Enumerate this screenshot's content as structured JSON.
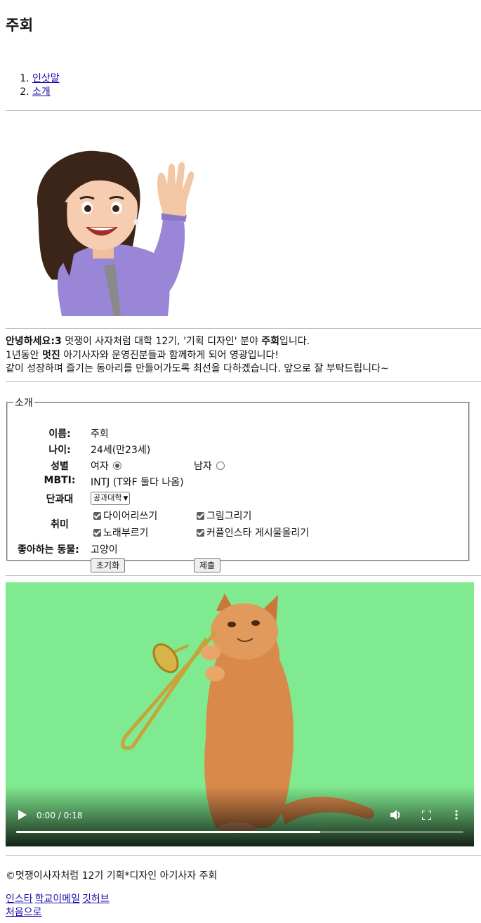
{
  "header": {
    "title": "주회"
  },
  "toc": {
    "items": [
      "인삿말",
      "소개"
    ]
  },
  "greeting": {
    "line1_bold": "안녕하세요:3",
    "line1_rest_a": " 멋쟁이 사자처럼 대학 12기, '기획 디자인' 분야 ",
    "line1_name": "주회",
    "line1_end": "입니다.",
    "line2_a": "1년동안 ",
    "line2_bold": "멋진",
    "line2_b": " 아기사자와 운영진분들과 함께하게 되어 영광입니다!",
    "line3": "같이 성장하며 즐기는 동아리를 만들어가도록 최선을 다하겠습니다. 앞으로 잘 부탁드립니다~"
  },
  "profile": {
    "legend": "소개",
    "name_label": "이름:",
    "name_value": "주회",
    "age_label": "나이:",
    "age_value": "24세(만23세)",
    "gender_label": "성별",
    "gender_female": "여자",
    "gender_male": "남자",
    "mbti_label": "MBTI:",
    "mbti_value": "INTJ (T와F 둘다 나옴)",
    "college_label": "단과대",
    "college_selected": "공과대학",
    "hobby_label": "취미",
    "hobbies": [
      "다이어리쓰기",
      "그림그리기",
      "노래부르기",
      "커플인스타 게시물올리기"
    ],
    "animal_label": "좋아하는 동물:",
    "animal_value": "고양이",
    "reset_label": "초기화",
    "submit_label": "제출"
  },
  "video": {
    "time": "0:00 / 0:18",
    "progress": 0.68
  },
  "footer": {
    "copyright": "©멋쟁이사자처럼 12기 기획*디자인 아기사자 주회",
    "links": [
      "인스타",
      "학교이메일",
      "깃허브"
    ],
    "top_link": "처음으로"
  },
  "colors": {
    "video_bg": "#80ea90",
    "link": "#1a0dab",
    "avatar_jacket": "#9a86d6",
    "cat_fur": "#d98a4a"
  }
}
